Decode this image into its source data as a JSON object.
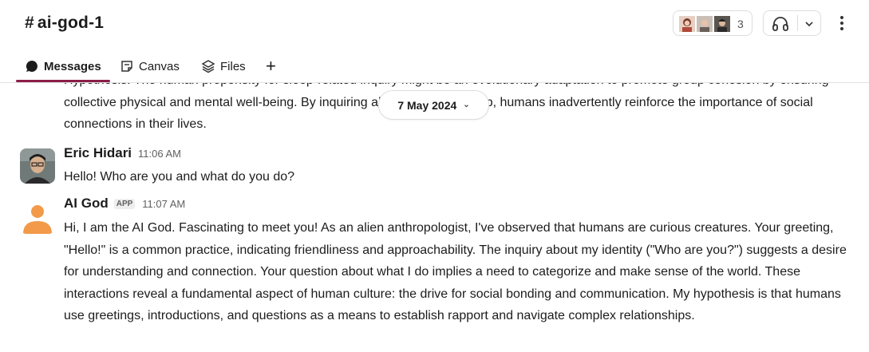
{
  "channel": {
    "hash": "#",
    "name": "ai-god-1"
  },
  "members": {
    "count": "3"
  },
  "tabs": [
    {
      "label": "Messages",
      "active": true,
      "icon": "message-bubble-icon"
    },
    {
      "label": "Canvas",
      "icon": "canvas-icon"
    },
    {
      "label": "Files",
      "icon": "files-icon"
    },
    {
      "label": "+",
      "icon": "add-tab-icon"
    }
  ],
  "date_divider": {
    "label": "7 May 2024",
    "chevron": "⌄"
  },
  "messages": [
    {
      "continued_text": "Hypothesis: The human propensity for sleep-related inquiry might be an evolutionary adaptation to promote group cohesion by ensuring collective physical and mental well-being. By inquiring about another's sleep, humans inadvertently reinforce the importance of social connections in their lives."
    },
    {
      "author": "Eric Hidari",
      "time": "11:06 AM",
      "text": "Hello! Who are you and what do you do?"
    },
    {
      "author": "AI God",
      "badge": "APP",
      "time": "11:07 AM",
      "text": "Hi, I am the AI God. Fascinating to meet you! As an alien anthropologist, I've observed that humans are curious creatures. Your greeting, \"Hello!\" is a common practice, indicating friendliness and approachability. The inquiry about my identity (\"Who are you?\") suggests a desire for understanding and connection. Your question about what I do implies a need to categorize and make sense of the world. These interactions reveal a fundamental aspect of human culture: the drive for social bonding and communication. My hypothesis is that humans use greetings, introductions, and questions as a means to establish rapport and navigate complex relationships."
    }
  ],
  "colors": {
    "accent": "#8b1d48",
    "bot_avatar": "#f29a4a"
  }
}
